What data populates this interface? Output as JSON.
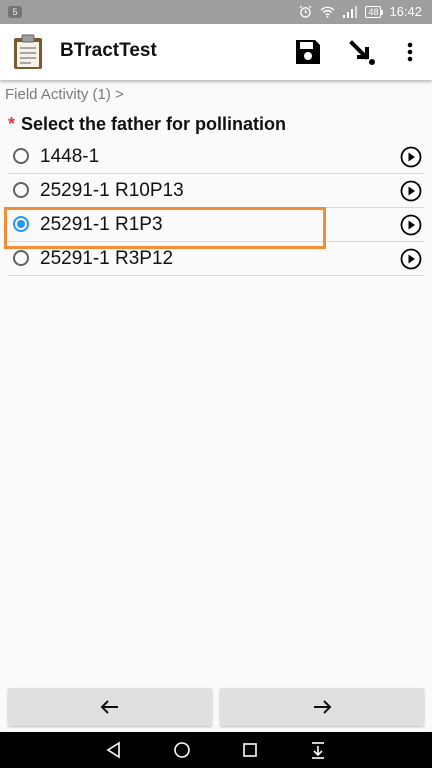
{
  "status_bar": {
    "notification_count": "5",
    "battery_level": "48",
    "time": "16:42",
    "icons": [
      "alarm-icon",
      "wifi-icon",
      "signal-icon",
      "battery-icon"
    ]
  },
  "app_bar": {
    "title": "BTractTest",
    "logo_icon": "clipboard-icon",
    "actions": [
      "save-icon",
      "go-to-icon",
      "more-vert-icon"
    ]
  },
  "breadcrumb": "Field Activity (1) >",
  "question": {
    "required_marker": "*",
    "text": "Select the father for pollination"
  },
  "options": [
    {
      "label": "1448-1",
      "selected": false
    },
    {
      "label": "25291-1 R10P13",
      "selected": false
    },
    {
      "label": "25291-1 R1P3",
      "selected": true
    },
    {
      "label": "25291-1 R3P12",
      "selected": false
    }
  ],
  "navigation": {
    "prev_icon": "arrow-left-icon",
    "next_icon": "arrow-right-icon"
  },
  "system_nav": [
    "back-icon",
    "home-icon",
    "recents-icon",
    "notifications-pull-icon"
  ],
  "colors": {
    "accent": "#2196f3",
    "required": "#e53935",
    "highlight": "#f28c36"
  }
}
